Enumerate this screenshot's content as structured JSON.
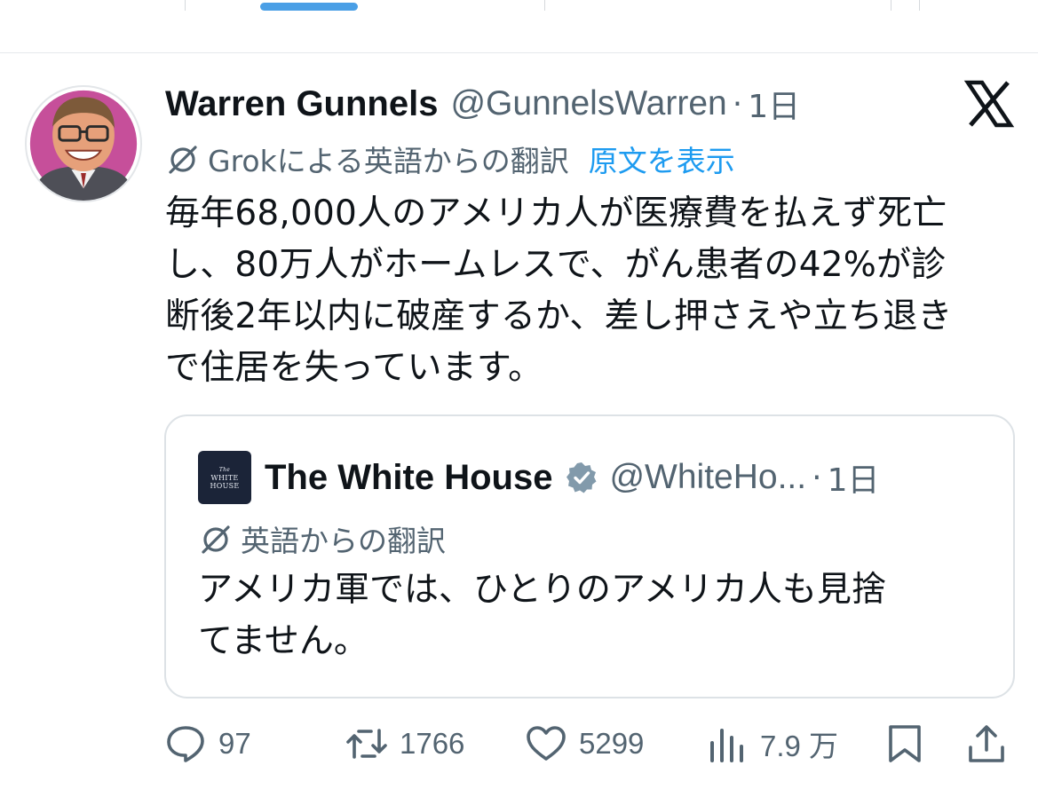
{
  "tweet": {
    "author_name": "Warren Gunnels",
    "author_handle": "@GunnelsWarren",
    "separator": "·",
    "time": "1日",
    "translation_label": "Grokによる英語からの翻訳",
    "show_original": "原文を表示",
    "text": "毎年68,000人のアメリカ人が医療費を払えず死亡\nし、80万人がホームレスで、がん患者の42%が診\n断後2年以内に破産するか、差し押さえや立ち退き\nで住居を失っています。"
  },
  "quoted_tweet": {
    "avatar_text": [
      "The",
      "WHITE",
      "HOUSE"
    ],
    "author_name": "The White House",
    "author_handle": "@WhiteHo...",
    "separator": "·",
    "time": "1日",
    "translation_label": "英語からの翻訳",
    "text": "アメリカ軍では、ひとりのアメリカ人も見捨\nてません。",
    "verified_color": "#829aab"
  },
  "actions": {
    "replies": "97",
    "reposts": "1766",
    "likes": "5299",
    "views": "7.9 万"
  },
  "icons": [
    "x-logo-icon",
    "translate-icon",
    "verified-badge-icon",
    "reply-icon",
    "repost-icon",
    "like-icon",
    "views-icon",
    "bookmark-icon",
    "share-icon"
  ],
  "colors": {
    "link": "#1d9bf0",
    "secondary_text": "#536471",
    "tab_indicator": "#4a9fe6"
  }
}
